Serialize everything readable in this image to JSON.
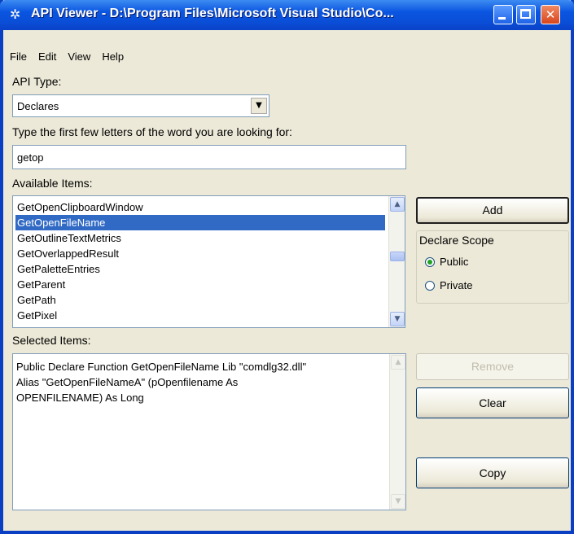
{
  "window": {
    "title": "API Viewer - D:\\Program Files\\Microsoft Visual Studio\\Co..."
  },
  "menu": [
    "File",
    "Edit",
    "View",
    "Help"
  ],
  "api_type": {
    "label": "API Type:",
    "selected": "Declares"
  },
  "search": {
    "label": "Type the first few letters of the word you are looking for:",
    "value": "getop"
  },
  "available_items": {
    "label": "Available Items:",
    "items": [
      "GetOpenClipboardWindow",
      "GetOpenFileName",
      "GetOutlineTextMetrics",
      "GetOverlappedResult",
      "GetPaletteEntries",
      "GetParent",
      "GetPath",
      "GetPixel"
    ],
    "selected_item": "GetOpenFileName"
  },
  "selected_items": {
    "label": "Selected Items:",
    "text": "Public Declare Function GetOpenFileName Lib \"comdlg32.dll\"\nAlias \"GetOpenFileNameA\" (pOpenfilename As\nOPENFILENAME) As Long"
  },
  "buttons": {
    "add": "Add",
    "remove": "Remove",
    "clear": "Clear",
    "copy": "Copy"
  },
  "declare_scope": {
    "label": "Declare Scope",
    "options": [
      "Public",
      "Private"
    ],
    "selected": "Public"
  }
}
